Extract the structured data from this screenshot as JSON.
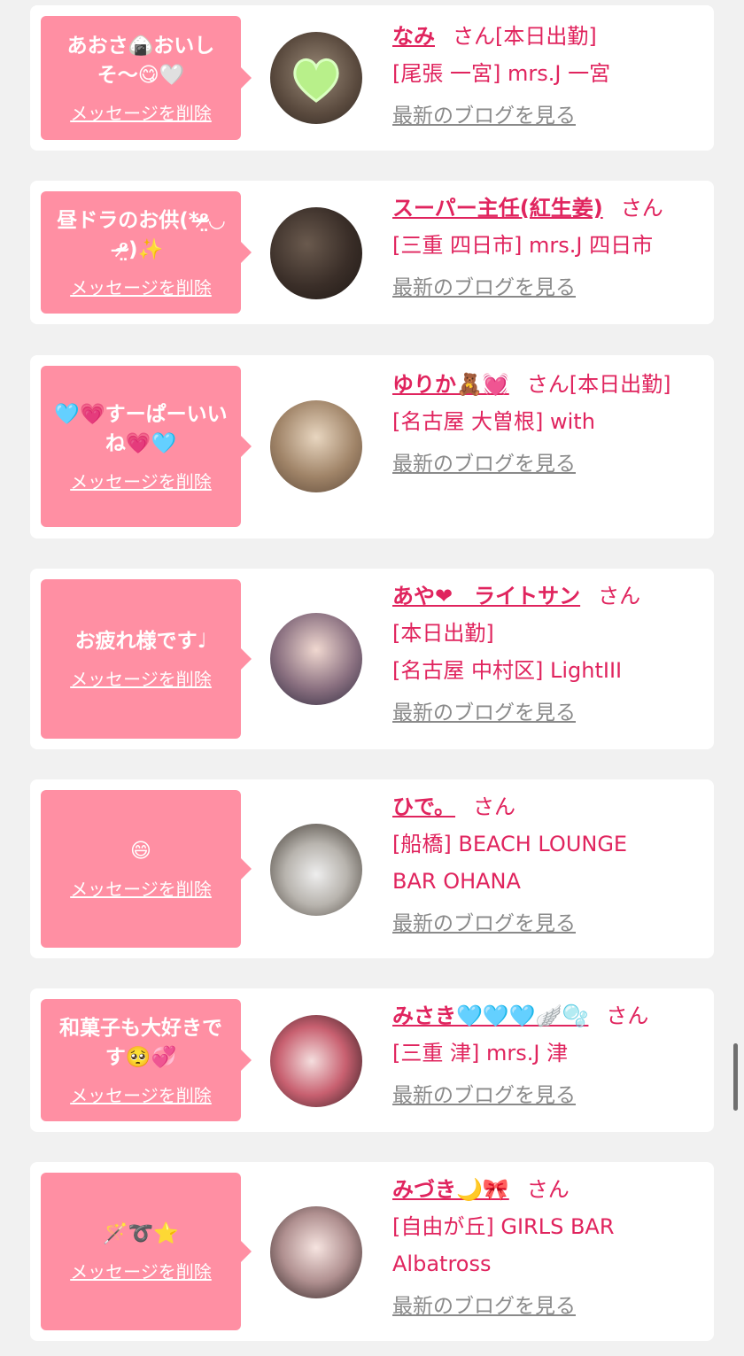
{
  "colors": {
    "page_bg": "#f1f1f1",
    "bubble": "#ff8fa3",
    "name": "#e0245e",
    "blog_link": "#8a8a8a"
  },
  "cards": [
    {
      "message": "あおさ🍙おいしそ〜😋🤍",
      "delete_label": "メッセージを削除",
      "name": "なみ",
      "suffix": "さん[本日出勤]",
      "info_lines": [
        "[尾張 一宮] mrs.J 一宮"
      ],
      "blog_label": "最新のブログを見る",
      "avatar_icon": "green-heart-avatar"
    },
    {
      "message": "昼ドラのお供(*ᵒ̴̶̷̤◡ᵒ̴̶̷̤)✨",
      "delete_label": "メッセージを削除",
      "name": "スーパー主任(紅生姜)",
      "suffix": "さん",
      "info_lines": [
        "[三重 四日市] mrs.J 四日市"
      ],
      "blog_label": "最新のブログを見る",
      "avatar_icon": "dark-photo-avatar"
    },
    {
      "message": "🩵💗すーぱーいいね💗🩵",
      "delete_label": "メッセージを削除",
      "name": "ゆりか🧸💓",
      "suffix": "さん[本日出勤]",
      "info_lines": [
        "[名古屋 大曽根] with"
      ],
      "blog_label": "最新のブログを見る",
      "avatar_icon": "hair-photo-avatar"
    },
    {
      "message": "お疲れ様です♩",
      "delete_label": "メッセージを削除",
      "name": "あや❤︎　ライトサン",
      "suffix": "さん",
      "info_lines": [
        "[本日出勤]",
        "[名古屋 中村区] LightIII"
      ],
      "blog_label": "最新のブログを見る",
      "avatar_icon": "selfie-photo-avatar"
    },
    {
      "message": "😄",
      "delete_label": "メッセージを削除",
      "name": "ひで。",
      "suffix": "さん",
      "info_lines": [
        "[船橋] BEACH LOUNGE",
        "BAR OHANA"
      ],
      "blog_label": "最新のブログを見る",
      "avatar_icon": "plush-photo-avatar"
    },
    {
      "message": "和菓子も大好きです🥺💞",
      "delete_label": "メッセージを削除",
      "name": "みさき🩵🩵🩵🪽🫧",
      "suffix": "さん",
      "info_lines": [
        "[三重 津] mrs.J 津"
      ],
      "blog_label": "最新のブログを見る",
      "avatar_icon": "costume-photo-avatar"
    },
    {
      "message": "🪄➰⭐️",
      "delete_label": "メッセージを削除",
      "name": "みづき🌙🎀",
      "suffix": "さん",
      "info_lines": [
        "[自由が丘] GIRLS BAR",
        "Albatross"
      ],
      "blog_label": "最新のブログを見る",
      "avatar_icon": "face-photo-avatar"
    }
  ]
}
